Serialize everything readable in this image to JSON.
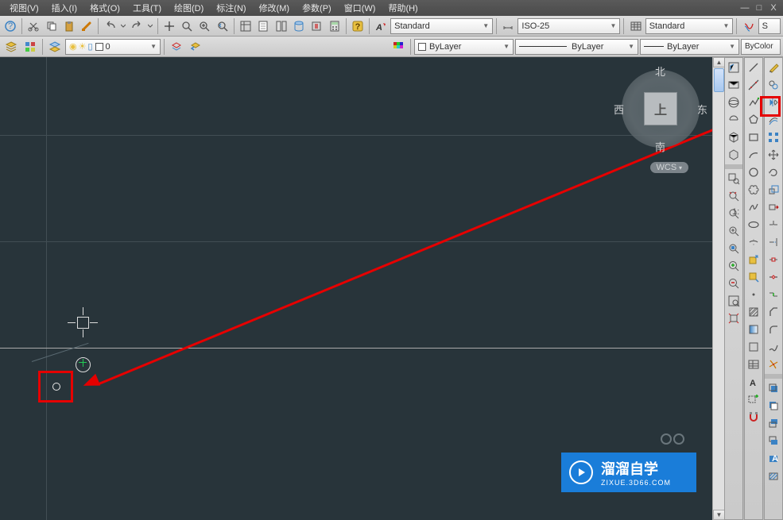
{
  "menubar": {
    "items": [
      "视图(V)",
      "插入(I)",
      "格式(O)",
      "工具(T)",
      "绘图(D)",
      "标注(N)",
      "修改(M)",
      "参数(P)",
      "窗口(W)",
      "帮助(H)"
    ]
  },
  "window_controls": {
    "min": "—",
    "sep": "□",
    "close": "X"
  },
  "toolbar1": {
    "text_style": "Standard",
    "dim_style": "ISO-25",
    "table_style": "Standard",
    "mls_style": "S"
  },
  "toolbar2": {
    "layer_combo": "0",
    "line_layer": "ByLayer",
    "linetype": "ByLayer",
    "linetype2": "ByLayer",
    "color": "ByColor"
  },
  "viewcube": {
    "north": "北",
    "south": "南",
    "east": "东",
    "west": "西",
    "top": "上",
    "wcs": "WCS"
  },
  "watermark": {
    "title": "溜溜自学",
    "subtitle": "ZIXUE.3D66.COM"
  },
  "icons": {
    "globe": "⊕",
    "bulb": "💡",
    "sun": "☀",
    "lock": "🔒",
    "layers": "▤",
    "house": "⌂"
  }
}
